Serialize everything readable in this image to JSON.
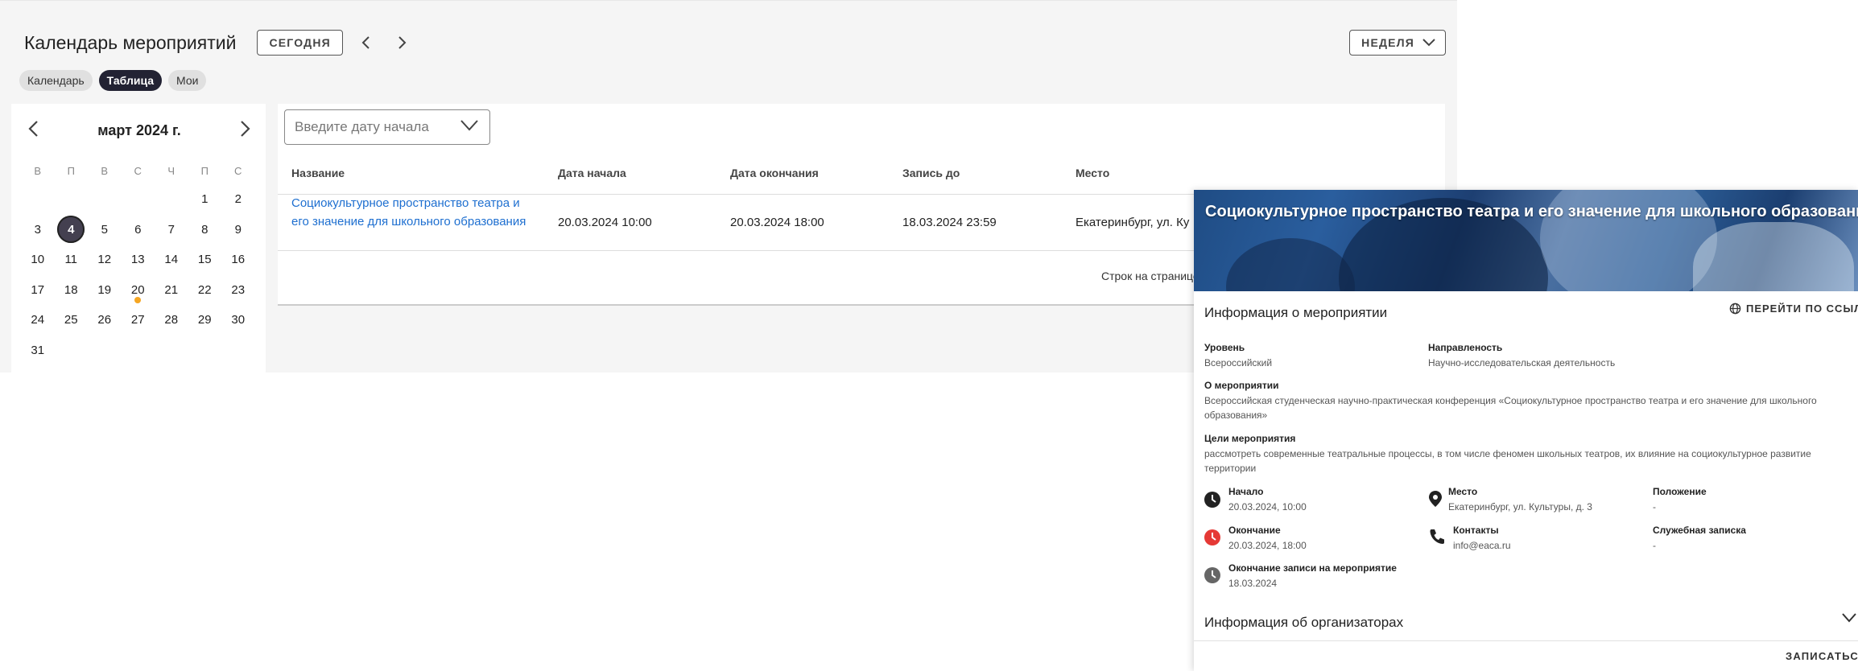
{
  "header": {
    "title": "Календарь мероприятий",
    "today_label": "СЕГОДНЯ",
    "view_select": "НЕДЕЛЯ"
  },
  "view_chips": [
    {
      "label": "Календарь",
      "active": false
    },
    {
      "label": "Таблица",
      "active": true
    },
    {
      "label": "Мои",
      "active": false
    }
  ],
  "mini_calendar": {
    "month_label": "март 2024 г.",
    "weekdays": [
      "В",
      "П",
      "В",
      "С",
      "Ч",
      "П",
      "С"
    ],
    "leading_blanks": 5,
    "days": [
      "1",
      "2",
      "3",
      "4",
      "5",
      "6",
      "7",
      "8",
      "9",
      "10",
      "11",
      "12",
      "13",
      "14",
      "15",
      "16",
      "17",
      "18",
      "19",
      "20",
      "21",
      "22",
      "23",
      "24",
      "25",
      "26",
      "27",
      "28",
      "29",
      "30",
      "31"
    ],
    "selected_day": "4",
    "event_days": [
      "20"
    ]
  },
  "table": {
    "date_filter_placeholder": "Введите дату начала",
    "columns": [
      "Название",
      "Дата начала",
      "Дата окончания",
      "Запись до",
      "Место"
    ],
    "rows": [
      {
        "name": "Социокультурное пространство театра и его значение для школьного образования",
        "start": "20.03.2024 10:00",
        "end": "20.03.2024 18:00",
        "signup_until": "18.03.2024 23:59",
        "place": "Екатеринбург, ул. Ку"
      }
    ],
    "rows_per_page_label": "Строк на странице"
  },
  "event_panel": {
    "banner_title": "Социокультурное пространство театра и его значение для школьного образования",
    "info_title": "Информация о мероприятии",
    "go_link_label": "ПЕРЕЙТИ ПО ССЫЛКЕ",
    "level_label": "Уровень",
    "level_value": "Всероссийский",
    "direction_label": "Направленость",
    "direction_value": "Научно-исследовательская деятельность",
    "about_label": "О мероприятии",
    "about_line1": "Всероссийская студенческая научно-практическая конференция «Социокультурное пространство театра и его значение для школьного",
    "about_line2": "образования»",
    "goals_label": "Цели мероприятия",
    "goals_line1": "рассмотреть современные театральные процессы, в том числе феномен школьных театров, их влияние на социокультурное развитие",
    "goals_line2": "территории",
    "start_label": "Начало",
    "start_value": "20.03.2024, 10:00",
    "place_label": "Место",
    "place_value": "Екатеринбург, ул. Культуры, д. 3",
    "regulation_label": "Положение",
    "regulation_value": "-",
    "end_label": "Окончание",
    "end_value": "20.03.2024, 18:00",
    "contacts_label": "Контакты",
    "contacts_value": "info@eaca.ru",
    "memo_label": "Служебная записка",
    "memo_value": "-",
    "signup_end_label": "Окончание записи на мероприятие",
    "signup_end_value": "18.03.2024",
    "organizers_title": "Информация об организаторах",
    "register_label": "ЗАПИСАТЬСЯ"
  },
  "colors": {
    "accent_link": "#1e6fd0",
    "chip_active": "#222233",
    "event_dot": "#f5a623",
    "end_icon": "#e53935"
  }
}
